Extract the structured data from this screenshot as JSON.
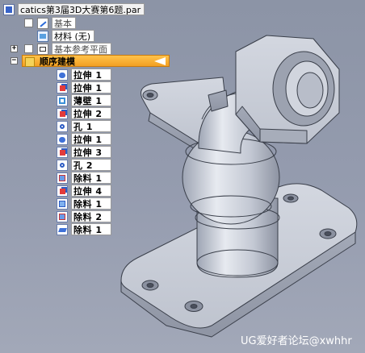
{
  "tree": {
    "root": {
      "label": "catics第3届3D大赛第6题.par",
      "icon": "part-file-icon"
    },
    "items": [
      {
        "label": "基本",
        "icon": "sketch-icon"
      },
      {
        "label": "材料 (无)",
        "icon": "material-icon"
      },
      {
        "label": "基本参考平面",
        "icon": "reference-plane-icon",
        "expander": "+"
      },
      {
        "label": "顺序建模",
        "icon": "sequential-modeling-icon",
        "expander": "−",
        "active": true
      }
    ],
    "features": [
      {
        "label": "拉伸 1",
        "icon": "revolve-icon"
      },
      {
        "label": "拉伸 1",
        "icon": "extrude-icon"
      },
      {
        "label": "薄壁 1",
        "icon": "thin-wall-icon"
      },
      {
        "label": "拉伸 2",
        "icon": "extrude-icon"
      },
      {
        "label": "孔 1",
        "icon": "hole-icon"
      },
      {
        "label": "拉伸 1",
        "icon": "revolve-icon"
      },
      {
        "label": "拉伸 3",
        "icon": "extrude-icon"
      },
      {
        "label": "孔 2",
        "icon": "hole-icon"
      },
      {
        "label": "除料 1",
        "icon": "cut-icon"
      },
      {
        "label": "拉伸 4",
        "icon": "extrude-icon"
      },
      {
        "label": "除料 1",
        "icon": "cut-icon"
      },
      {
        "label": "除料 2",
        "icon": "cut-icon"
      },
      {
        "label": "除料 1",
        "icon": "draft-icon"
      }
    ]
  },
  "watermark": "UG爱好者论坛@xwhhr",
  "colors": {
    "background": "#959caf",
    "model_face": "#c9ced9",
    "model_edge": "#3a3f4a",
    "active_row": "#f5a52a"
  }
}
